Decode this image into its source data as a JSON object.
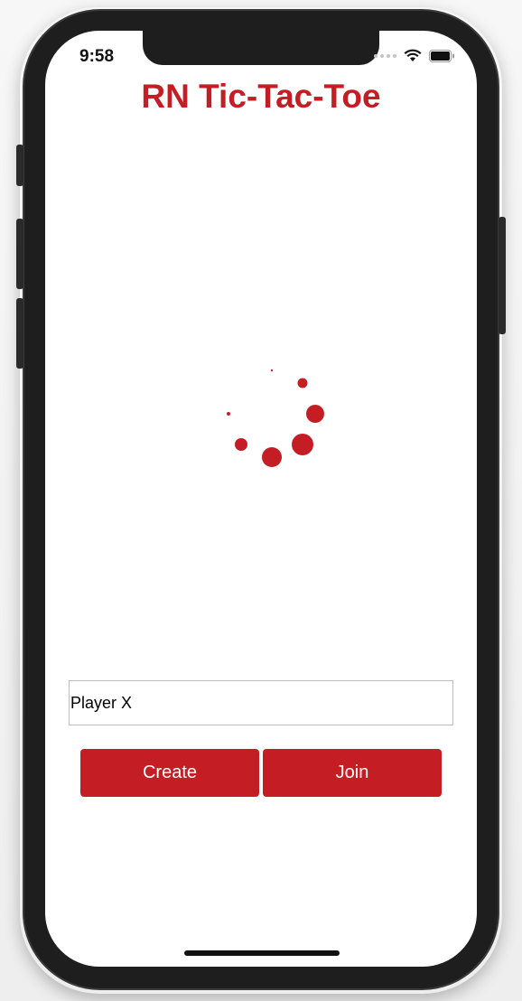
{
  "status_bar": {
    "time": "9:58",
    "wifi_icon": "wifi-icon",
    "battery_icon": "battery-icon"
  },
  "app": {
    "title": "RN Tic-Tac-Toe",
    "spinner_icon": "loading-spinner-icon",
    "accent_color": "#c41e24"
  },
  "form": {
    "name_value": "Player X",
    "create_label": "Create",
    "join_label": "Join"
  }
}
